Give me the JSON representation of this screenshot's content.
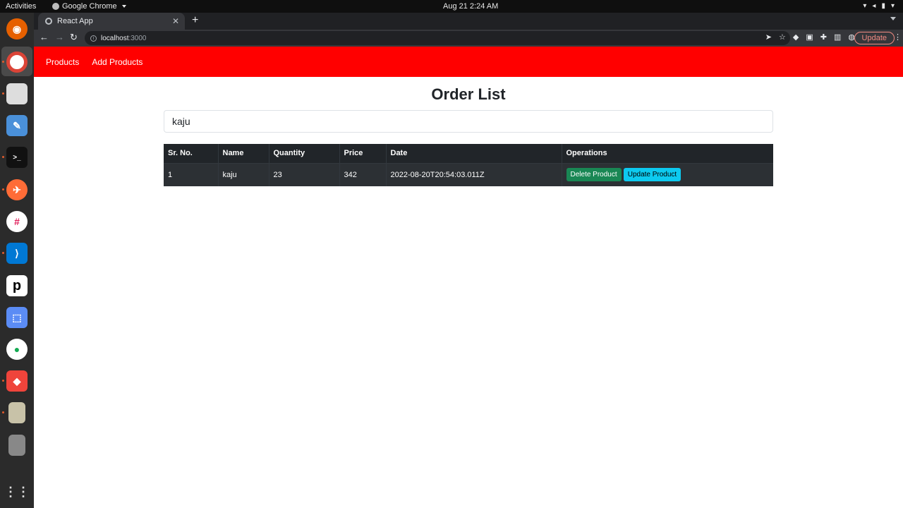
{
  "system": {
    "activities": "Activities",
    "app_name": "Google Chrome",
    "clock": "Aug 21  2:24 AM"
  },
  "browser": {
    "tab_title": "React App",
    "url_host": "localhost",
    "url_port": ":3000",
    "update_label": "Update"
  },
  "dock": [
    "firefox-icon",
    "chrome-icon",
    "files-icon",
    "text-editor-icon",
    "terminal-icon",
    "postman-icon",
    "slack-icon",
    "vscode-icon",
    "pycharm-icon",
    "screenshot-icon",
    "mongodb-compass-icon",
    "anydesk-icon",
    "archive-icon",
    "usb-drive-icon",
    "app-grid-icon"
  ],
  "navbar": {
    "links": [
      "Products",
      "Add Products"
    ],
    "bg_color": "#ff0000"
  },
  "main": {
    "title": "Order List",
    "search_value": "kaju"
  },
  "table": {
    "headers": [
      "Sr. No.",
      "Name",
      "Quantity",
      "Price",
      "Date",
      "Operations"
    ],
    "rows": [
      {
        "sr": "1",
        "name": "kaju",
        "quantity": "23",
        "price": "342",
        "date": "2022-08-20T20:54:03.011Z"
      }
    ],
    "delete_label": "Delete Product",
    "update_label": "Update Product"
  }
}
